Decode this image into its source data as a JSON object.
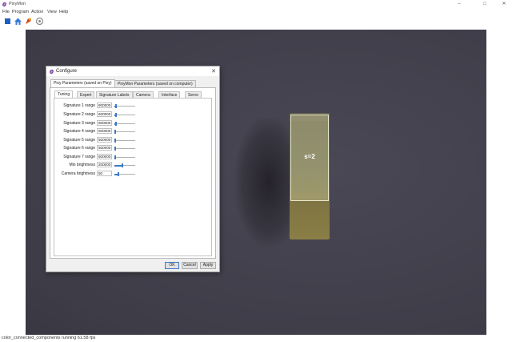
{
  "window": {
    "title": "PixyMon",
    "minimize": "–",
    "maximize": "□",
    "close": "✕"
  },
  "menu": [
    "File",
    "Program",
    "Action",
    "View",
    "Help"
  ],
  "toolbar": {
    "icons": [
      "stop-icon",
      "home-icon",
      "run-icon",
      "settings-icon"
    ],
    "colors": {
      "stop": "#1f5fbf",
      "home": "#3b7dd8",
      "run": "#d9461e",
      "settings": "#8a8a8a"
    }
  },
  "video": {
    "detection_label": "s=2"
  },
  "dialog": {
    "title": "Configure",
    "close": "✕",
    "outer_tabs": [
      {
        "label": "Pixy Parameters (saved on Pixy)",
        "active": true
      },
      {
        "label": "PixyMon Parameters (saved on computer)",
        "active": false
      }
    ],
    "inner_tabs": [
      {
        "label": "Tuning",
        "active": true
      },
      {
        "label": "Expert",
        "active": false
      },
      {
        "label": "Signature Labels",
        "active": false
      },
      {
        "label": "Camera",
        "active": false
      },
      {
        "label": "Interface",
        "active": false
      },
      {
        "label": "Servo",
        "active": false
      }
    ],
    "rows": [
      {
        "label": "Signature 1 range",
        "value": "800000",
        "level": 0.08
      },
      {
        "label": "Signature 2 range",
        "value": "600000",
        "level": 0.06
      },
      {
        "label": "Signature 3 range",
        "value": "600000",
        "level": 0.06
      },
      {
        "label": "Signature 4 range",
        "value": "500000",
        "level": 0.05
      },
      {
        "label": "Signature 5 range",
        "value": "500000",
        "level": 0.05
      },
      {
        "label": "Signature 6 range",
        "value": "500000",
        "level": 0.05
      },
      {
        "label": "Signature 7 range",
        "value": "500000",
        "level": 0.05
      },
      {
        "label": "Min brightness",
        "value": "200000",
        "level": 0.4
      },
      {
        "label": "Camera brightness",
        "value": "50",
        "level": 0.2
      }
    ],
    "buttons": {
      "ok": "OK",
      "cancel": "Cancel",
      "apply": "Apply"
    }
  },
  "status": {
    "text": "color_connected_components running 61.58 fps"
  },
  "colors": {
    "accent": "#3c7ac7",
    "detect_box": "#e8e6c8",
    "app_icon": "#7a3fa0"
  }
}
